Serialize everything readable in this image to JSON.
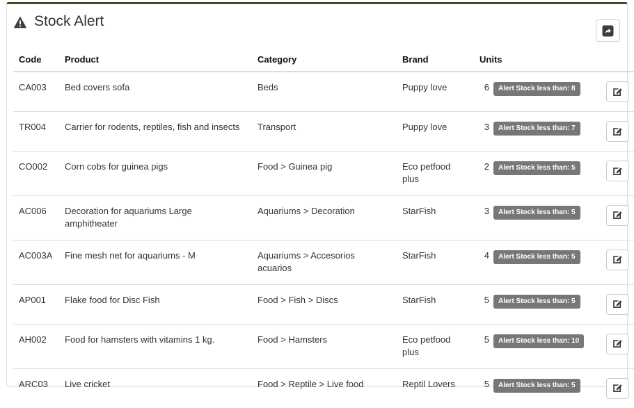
{
  "panel": {
    "accent_color": "#3f4a1f",
    "title": "Stock Alert",
    "warning_icon": "warning-triangle-icon",
    "export_button": {
      "icon": "share-export-icon",
      "label": ""
    }
  },
  "table": {
    "columns": [
      {
        "key": "code",
        "label": "Code"
      },
      {
        "key": "product",
        "label": "Product"
      },
      {
        "key": "category",
        "label": "Category"
      },
      {
        "key": "brand",
        "label": "Brand"
      },
      {
        "key": "units",
        "label": "Units"
      },
      {
        "key": "action",
        "label": ""
      }
    ],
    "badge_color": "#777777",
    "rows": [
      {
        "code": "CA003",
        "product": "Bed covers sofa",
        "category": "Beds",
        "brand": "Puppy love",
        "units": "6",
        "alert": "Alert Stock less than: 8",
        "action_icon": "edit-pencil-icon"
      },
      {
        "code": "TR004",
        "product": "Carrier for rodents, reptiles, fish and insects",
        "category": "Transport",
        "brand": "Puppy love",
        "units": "3",
        "alert": "Alert Stock less than: 7",
        "action_icon": "edit-pencil-icon"
      },
      {
        "code": "CO002",
        "product": "Corn cobs for guinea pigs",
        "category": "Food > Guinea pig",
        "brand": "Eco petfood plus",
        "units": "2",
        "alert": "Alert Stock less than: 5",
        "action_icon": "edit-pencil-icon"
      },
      {
        "code": "AC006",
        "product": "Decoration for aquariums Large amphitheater",
        "category": "Aquariums > Decoration",
        "brand": "StarFish",
        "units": "3",
        "alert": "Alert Stock less than: 5",
        "action_icon": "edit-pencil-icon"
      },
      {
        "code": "AC003A",
        "product": "Fine mesh net for aquariums - M",
        "category": "Aquariums > Accesorios acuarios",
        "brand": "StarFish",
        "units": "4",
        "alert": "Alert Stock less than: 5",
        "action_icon": "edit-pencil-icon"
      },
      {
        "code": "AP001",
        "product": "Flake food for Disc Fish",
        "category": "Food > Fish > Discs",
        "brand": "StarFish",
        "units": "5",
        "alert": "Alert Stock less than: 5",
        "action_icon": "edit-pencil-icon"
      },
      {
        "code": "AH002",
        "product": "Food for hamsters with vitamins 1 kg.",
        "category": "Food > Hamsters",
        "brand": "Eco petfood plus",
        "units": "5",
        "alert": "Alert Stock less than: 10",
        "action_icon": "edit-pencil-icon"
      },
      {
        "code": "ARC03",
        "product": "Live cricket",
        "category": "Food > Reptile > Live food",
        "brand": "Reptil Lovers",
        "units": "5",
        "alert": "Alert Stock less than: 5",
        "action_icon": "edit-pencil-icon"
      }
    ]
  }
}
